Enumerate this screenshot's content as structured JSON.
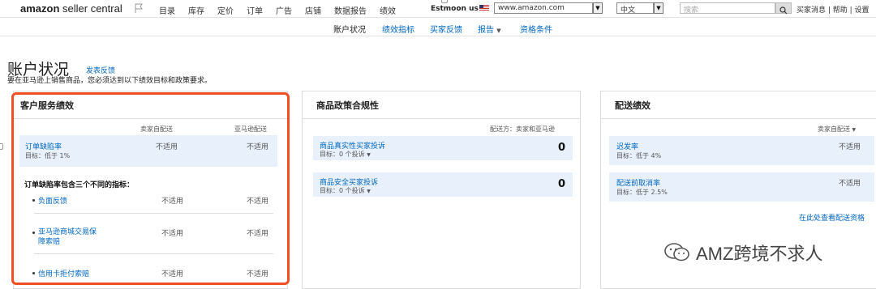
{
  "topbar": {
    "logo_bold": "amazon",
    "logo_rest": " seller central",
    "nav": [
      "目录",
      "库存",
      "定价",
      "订单",
      "广告",
      "店铺",
      "数据报告",
      "绩效"
    ],
    "store_name": "Estmoon us",
    "marketplace": "www.amazon.com",
    "language": "中文",
    "search_placeholder": "搜索",
    "links": "买家消息 | 帮助 | 设置"
  },
  "subnav": {
    "items": [
      "账户状况",
      "绩效指标",
      "买家反馈",
      "报告",
      "资格条件"
    ]
  },
  "page": {
    "title": "账户状况",
    "feedback_link": "发表反馈",
    "description": "要在亚马逊上销售商品，您必须达到以下绩效目标和政策要求。"
  },
  "customer_service": {
    "title": "客户服务绩效",
    "col_seller": "卖家自配送",
    "col_amazon": "亚马逊配送",
    "odr": {
      "label": "订单缺陷率",
      "target": "目标：低于 1%",
      "seller": "不适用",
      "amazon": "不适用"
    },
    "subtitle": "订单缺陷率包含三个不同的指标：",
    "metrics": [
      {
        "label": "负面反馈",
        "seller": "不适用",
        "amazon": "不适用"
      },
      {
        "label": "亚马逊商城交易保障索赔",
        "seller": "不适用",
        "amazon": "不适用"
      },
      {
        "label": "信用卡拒付索赔",
        "seller": "不适用",
        "amazon": "不适用"
      }
    ]
  },
  "policy": {
    "title": "商品政策合规性",
    "shipping_note": "配送方：卖家和亚马逊",
    "items": [
      {
        "label": "商品真实性买家投诉",
        "target": "目标：0 个投诉",
        "value": "0"
      },
      {
        "label": "商品安全买家投诉",
        "target": "目标：0 个投诉",
        "value": "0"
      }
    ]
  },
  "shipping": {
    "title": "配送绩效",
    "filter": "卖家自配送",
    "items": [
      {
        "label": "迟发率",
        "target": "目标：低于 4%",
        "value": "不适用"
      },
      {
        "label": "配送前取消率",
        "target": "目标：低于 2.5%",
        "value": "不适用"
      }
    ],
    "eligibility_link": "在此处查看配送资格"
  },
  "watermark": "AMZ跨境不求人",
  "colors": {
    "link": "#0066c0",
    "highlight": "#e8f1fb",
    "annotation": "#f04e23"
  }
}
